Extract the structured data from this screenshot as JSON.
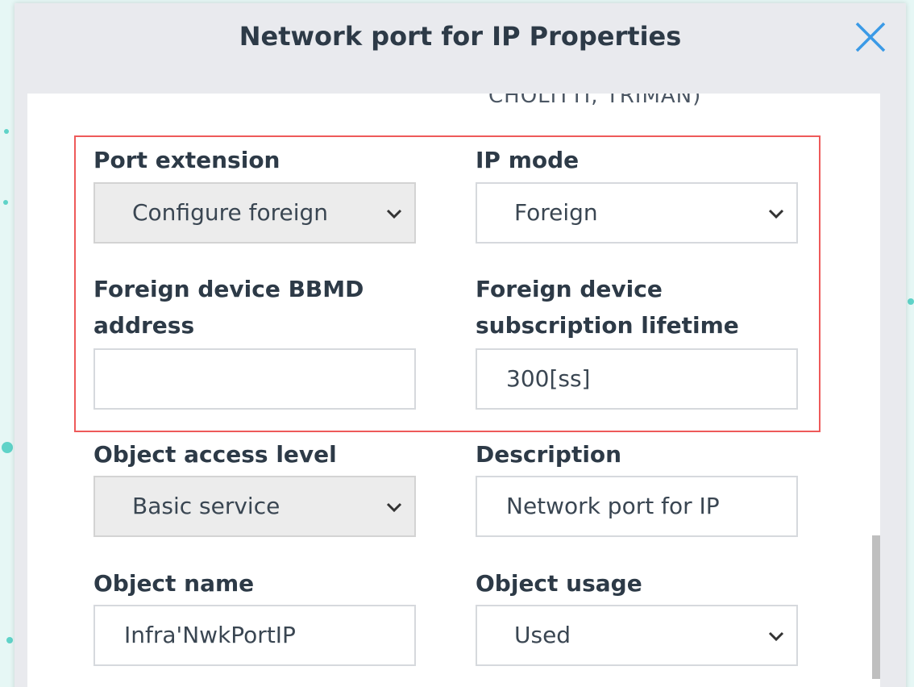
{
  "dialog": {
    "title": "Network port for IP Properties",
    "cut_text": "CHOLITTI, TRIMAN)"
  },
  "fields": {
    "port_extension": {
      "label": "Port extension",
      "value": "Configure foreign"
    },
    "ip_mode": {
      "label": "IP mode",
      "value": "Foreign"
    },
    "bbmd_address": {
      "label_line1": "Foreign device BBMD",
      "label_line2": "address",
      "value": ""
    },
    "subscription_lifetime": {
      "label_line1": "Foreign device",
      "label_line2": "subscription lifetime",
      "value": "300[ss]"
    },
    "object_access_level": {
      "label": "Object access level",
      "value": "Basic service"
    },
    "description": {
      "label": "Description",
      "value": "Network port for IP"
    },
    "object_name": {
      "label": "Object name",
      "value": "Infra'NwkPortIP"
    },
    "object_usage": {
      "label": "Object usage",
      "value": "Used"
    }
  },
  "colors": {
    "highlight_border": "#ee5a5a",
    "close_icon": "#3b9ae6"
  }
}
